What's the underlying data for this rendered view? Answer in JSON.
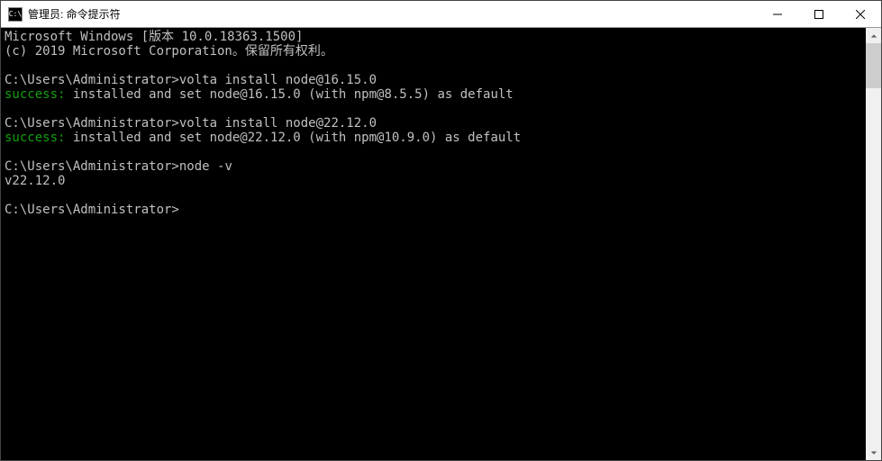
{
  "window": {
    "title": "管理员: 命令提示符",
    "icon_label": "C:\\"
  },
  "console": {
    "line1": "Microsoft Windows [版本 10.0.18363.1500]",
    "line2": "(c) 2019 Microsoft Corporation。保留所有权利。",
    "prompt1": "C:\\Users\\Administrator>",
    "cmd1": "volta install node@16.15.0",
    "success1_label": "success:",
    "success1_msg": " installed and set node@16.15.0 (with npm@8.5.5) as default",
    "prompt2": "C:\\Users\\Administrator>",
    "cmd2": "volta install node@22.12.0",
    "success2_label": "success:",
    "success2_msg": " installed and set node@22.12.0 (with npm@10.9.0) as default",
    "prompt3": "C:\\Users\\Administrator>",
    "cmd3": "node -v",
    "output3": "v22.12.0",
    "prompt4": "C:\\Users\\Administrator>"
  }
}
